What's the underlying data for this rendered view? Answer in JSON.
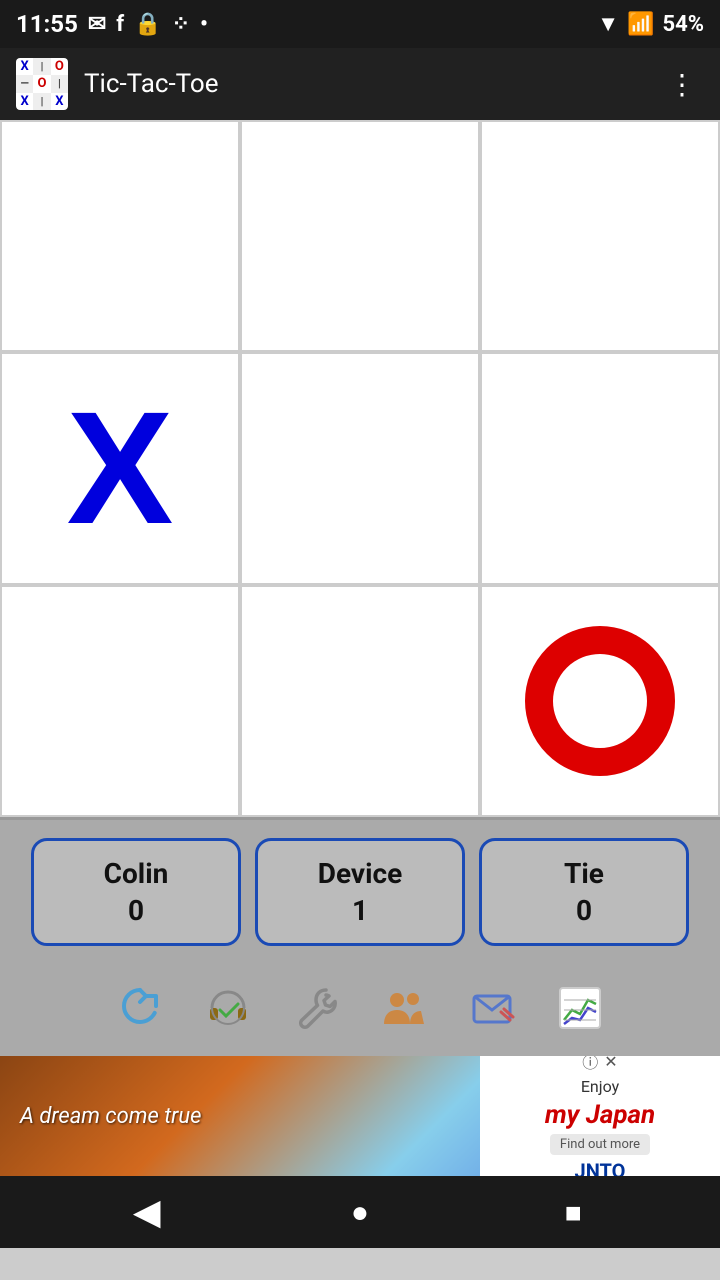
{
  "status": {
    "time": "11:55",
    "battery": "54%"
  },
  "appBar": {
    "title": "Tic-Tac-Toe"
  },
  "board": {
    "cells": [
      {
        "row": 0,
        "col": 0,
        "value": ""
      },
      {
        "row": 0,
        "col": 1,
        "value": ""
      },
      {
        "row": 0,
        "col": 2,
        "value": ""
      },
      {
        "row": 1,
        "col": 0,
        "value": "X"
      },
      {
        "row": 1,
        "col": 1,
        "value": ""
      },
      {
        "row": 1,
        "col": 2,
        "value": ""
      },
      {
        "row": 2,
        "col": 0,
        "value": ""
      },
      {
        "row": 2,
        "col": 1,
        "value": ""
      },
      {
        "row": 2,
        "col": 2,
        "value": "O"
      }
    ]
  },
  "scores": [
    {
      "label": "Colin",
      "value": "0"
    },
    {
      "label": "Device",
      "value": "1"
    },
    {
      "label": "Tie",
      "value": "0"
    }
  ],
  "toolbar": {
    "icons": [
      "refresh",
      "headset",
      "wrench",
      "users",
      "mail",
      "chart"
    ]
  },
  "ad": {
    "text": "A dream come true",
    "brand": "Enjoy my Japan",
    "cta": "Find out more",
    "logo": "JNTO"
  },
  "nav": {
    "back": "◀",
    "home": "●",
    "recent": "■"
  }
}
